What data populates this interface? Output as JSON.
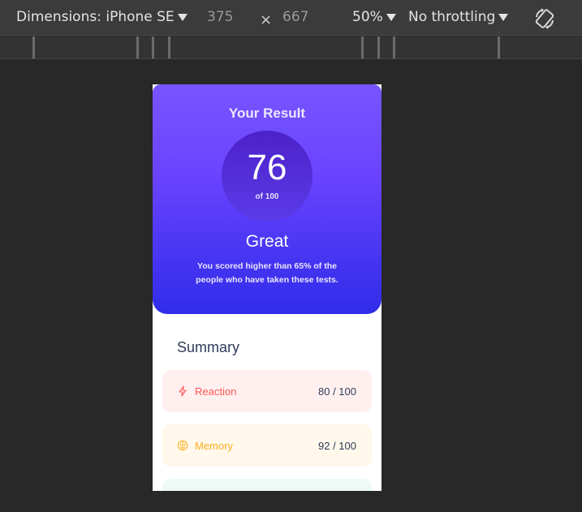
{
  "devtools": {
    "dimensions_label": "Dimensions: iPhone SE",
    "width": "375",
    "times": "×",
    "height": "667",
    "zoom": "50%",
    "throttling": "No throttling"
  },
  "result": {
    "title": "Your Result",
    "score": "76",
    "score_total": "of 100",
    "grade": "Great",
    "description": "You scored higher than 65% of the people who have taken these tests."
  },
  "summary": {
    "title": "Summary",
    "items": [
      {
        "label": "Reaction",
        "score": "80 / 100",
        "icon": "lightning-icon",
        "color": "#ff5757"
      },
      {
        "label": "Memory",
        "score": "92 / 100",
        "icon": "brain-icon",
        "color": "#ffb01f"
      },
      {
        "label": "",
        "score": "",
        "icon": "",
        "color": "#00bb8f"
      }
    ]
  },
  "colors": {
    "gradient_top": "#7755ff",
    "gradient_bottom": "#2f2ce9",
    "devtools_bg": "#3b3b3b"
  }
}
